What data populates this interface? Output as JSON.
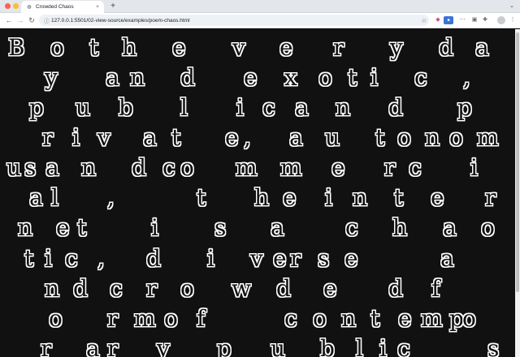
{
  "browser": {
    "tab_title": "Crowded Chaos",
    "tab_icon": "globe-icon",
    "url": "127.0.0.1:5501/02-view-source/examples/poem-chaos.html",
    "new_tab_label": "+",
    "close_label": "×"
  },
  "poem": {
    "text": "Both everyday and exotic, public and private, autonomous and commercial, the internet is a chaotic, diverse and crowded form of contemporary public s",
    "lines": [
      "B o t h e v e r y d a",
      "y a n d e x o t i c ,",
      "p u b l i c a n d p",
      "r i v a t e , a u t o n o m o",
      "u s a n d c o m m e r c i",
      "a l , t h e i n t e r",
      "n e t i s a c h a o",
      "t i c , d i v e r s e a",
      "n d c r o w d e d f",
      "o r m o f c o n t e m p o",
      "r a r y p u b l i c s"
    ]
  }
}
